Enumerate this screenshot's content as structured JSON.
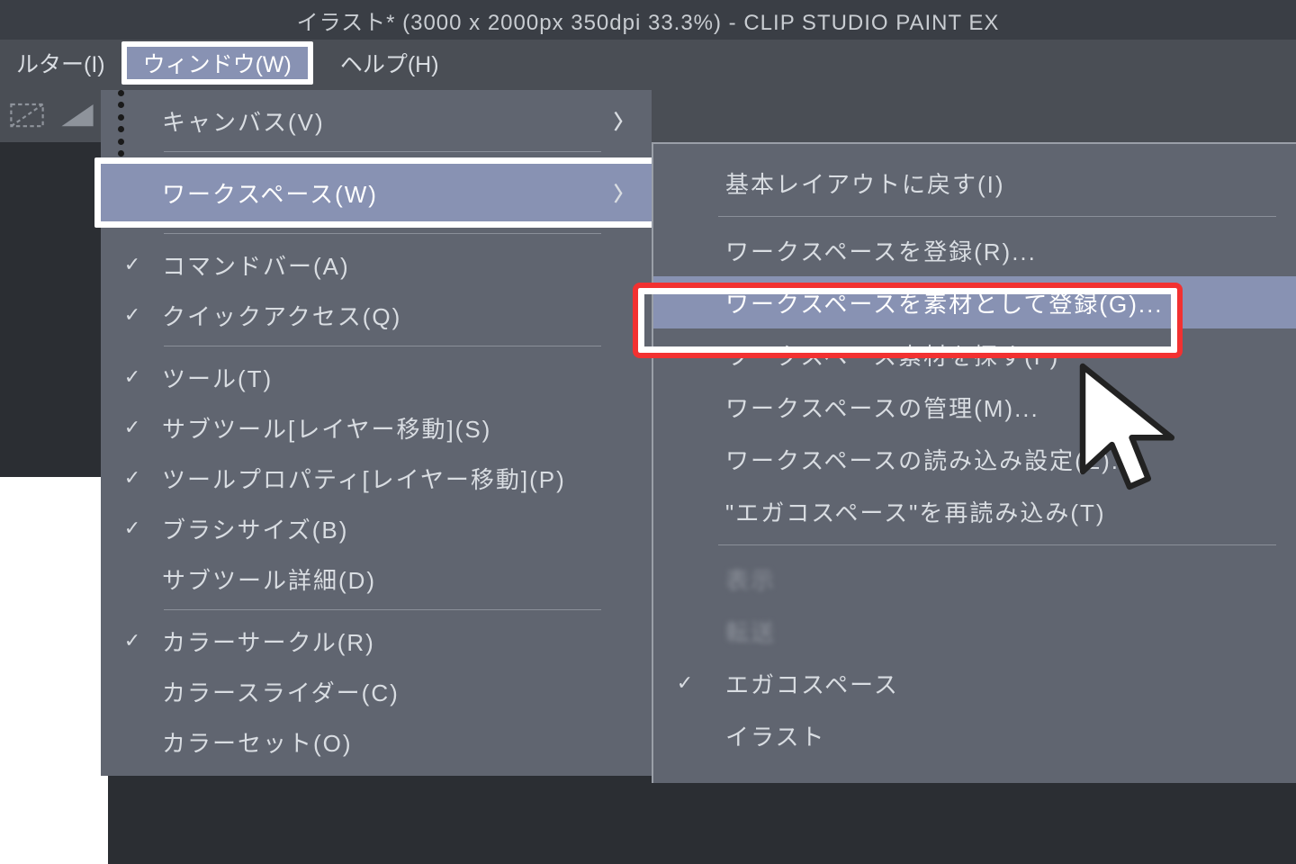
{
  "titlebar": "イラスト* (3000 x 2000px 350dpi 33.3%)  -  CLIP STUDIO PAINT EX",
  "menubar": {
    "filter": "ルター(I)",
    "window": "ウィンドウ(W)",
    "help": "ヘルプ(H)"
  },
  "menu1": {
    "canvas": "キャンバス(V)",
    "workspace": "ワークスペース(W)",
    "commandbar": "コマンドバー(A)",
    "quickaccess": "クイックアクセス(Q)",
    "tool": "ツール(T)",
    "subtool": "サブツール[レイヤー移動](S)",
    "toolprop": "ツールプロパティ[レイヤー移動](P)",
    "brushsize": "ブラシサイズ(B)",
    "subtooldetail": "サブツール詳細(D)",
    "colorcircle": "カラーサークル(R)",
    "colorslider": "カラースライダー(C)",
    "colorset": "カラーセット(O)"
  },
  "menu2": {
    "reset": "基本レイアウトに戻す(I)",
    "register": "ワークスペースを登録(R)...",
    "registermat": "ワークスペースを素材として登録(G)...",
    "search": "ワークスペース素材を探す(F)",
    "manage": "ワークスペースの管理(M)...",
    "readsetting": "ワークスペースの読み込み設定(E)...",
    "reload": "\"エガコスペース\"を再読み込み(T)",
    "blur1": "表示",
    "blur2": "転送",
    "egako": "エガコスペース",
    "illust": "イラスト"
  }
}
